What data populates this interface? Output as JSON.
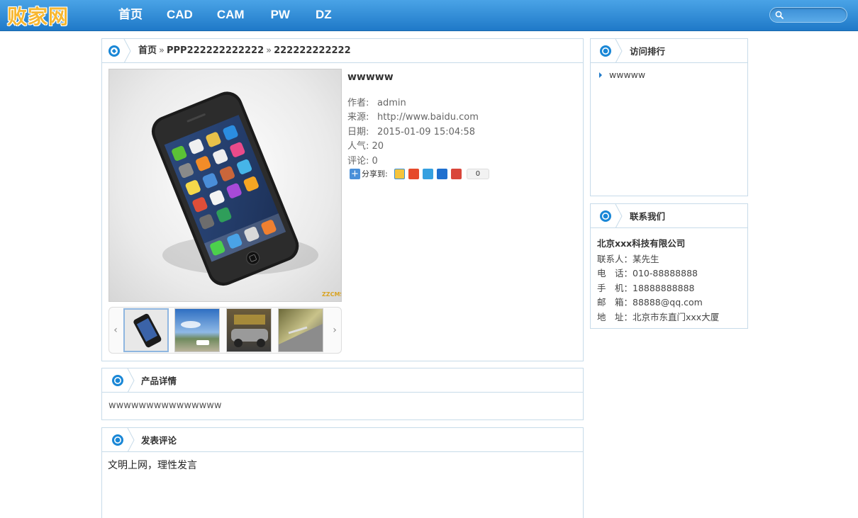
{
  "site": {
    "logo": "败家网",
    "nav": [
      "首页",
      "CAD",
      "CAM",
      "PW",
      "DZ"
    ],
    "search": {
      "placeholder": ""
    }
  },
  "breadcrumb": {
    "home": "首页",
    "sep": "»",
    "category": "PPP222222222222",
    "current": "222222222222"
  },
  "product": {
    "title": "wwwww",
    "meta": [
      {
        "label": "作者:",
        "value": "admin"
      },
      {
        "label": "来源:",
        "value": "http://www.baidu.com"
      },
      {
        "label": "日期:",
        "value": "2015-01-09 15:04:58"
      },
      {
        "label": "人气:",
        "value": "20"
      },
      {
        "label": "评论:",
        "value": "0"
      }
    ],
    "share_label": "分享到:",
    "share_count": "0",
    "thumbnail_count": 4,
    "image_watermark": "ZZCMS"
  },
  "sections": {
    "detail": {
      "title": "产品详情",
      "text": "wwwwwwwwwwwwwww"
    },
    "comment": {
      "title": "发表评论",
      "text": "文明上网，理性发言"
    }
  },
  "sidebar": {
    "ranking": {
      "title": "访问排行",
      "items": [
        "wwwww"
      ]
    },
    "contact": {
      "title": "联系我们",
      "company": "北京xxx科技有限公司",
      "lines": [
        "联系人：某先生",
        "电　话：010-88888888",
        "手　机：18888888888",
        "邮　箱：88888@qq.com",
        "地　址：北京市东直门xxx大厦"
      ]
    }
  },
  "colors": {
    "topbar": "#1f79c8",
    "logo": "#f7b731",
    "panel_border": "#c7dbe9",
    "accent": "#1a87d6"
  },
  "icons": {
    "panel_badge": "aperture-icon",
    "search": "search-icon",
    "share": [
      "qzone-icon",
      "weibo-icon",
      "tencent-icon",
      "renren-icon",
      "kaixin-icon"
    ]
  }
}
